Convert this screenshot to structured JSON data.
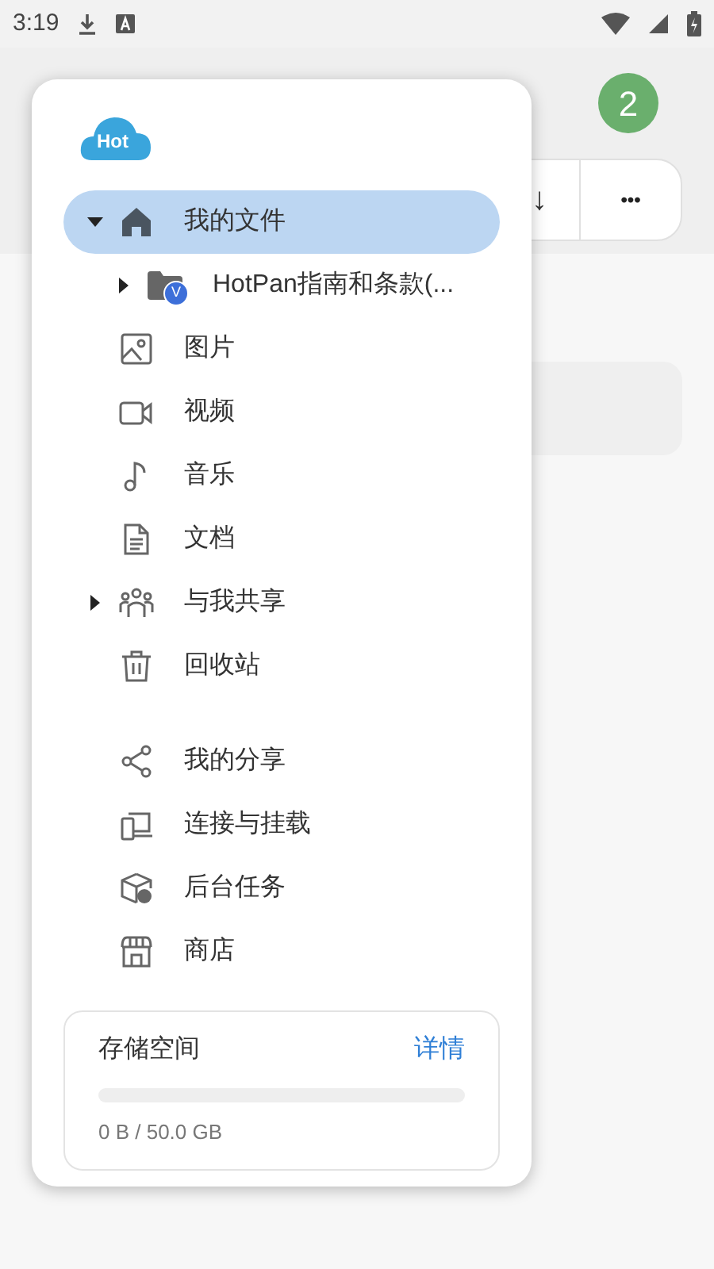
{
  "status_bar": {
    "time": "3:19"
  },
  "background": {
    "badge": "2",
    "toolbar_buttons": [
      "↓",
      "•••"
    ]
  },
  "drawer": {
    "logo": "Hot",
    "sections": [
      {
        "items": [
          {
            "label": "我的文件",
            "selected": true,
            "expanded": true,
            "children": [
              {
                "label": "HotPan指南和条款(...",
                "selected": false,
                "expanded": false,
                "badge": "V"
              }
            ]
          },
          {
            "label": "图片",
            "selected": false
          },
          {
            "label": "视频",
            "selected": false
          },
          {
            "label": "音乐",
            "selected": false
          },
          {
            "label": "文档",
            "selected": false
          },
          {
            "label": "与我共享",
            "selected": false,
            "expanded": false
          },
          {
            "label": "回收站",
            "selected": false
          }
        ]
      },
      {
        "items": [
          {
            "label": "我的分享",
            "selected": false
          },
          {
            "label": "连接与挂载",
            "selected": false
          },
          {
            "label": "后台任务",
            "selected": false
          },
          {
            "label": "商店",
            "selected": false
          }
        ]
      }
    ],
    "storage": {
      "title": "存储空间",
      "link": "详情",
      "level": 0,
      "reading": "0 B / 50.0 GB"
    }
  }
}
